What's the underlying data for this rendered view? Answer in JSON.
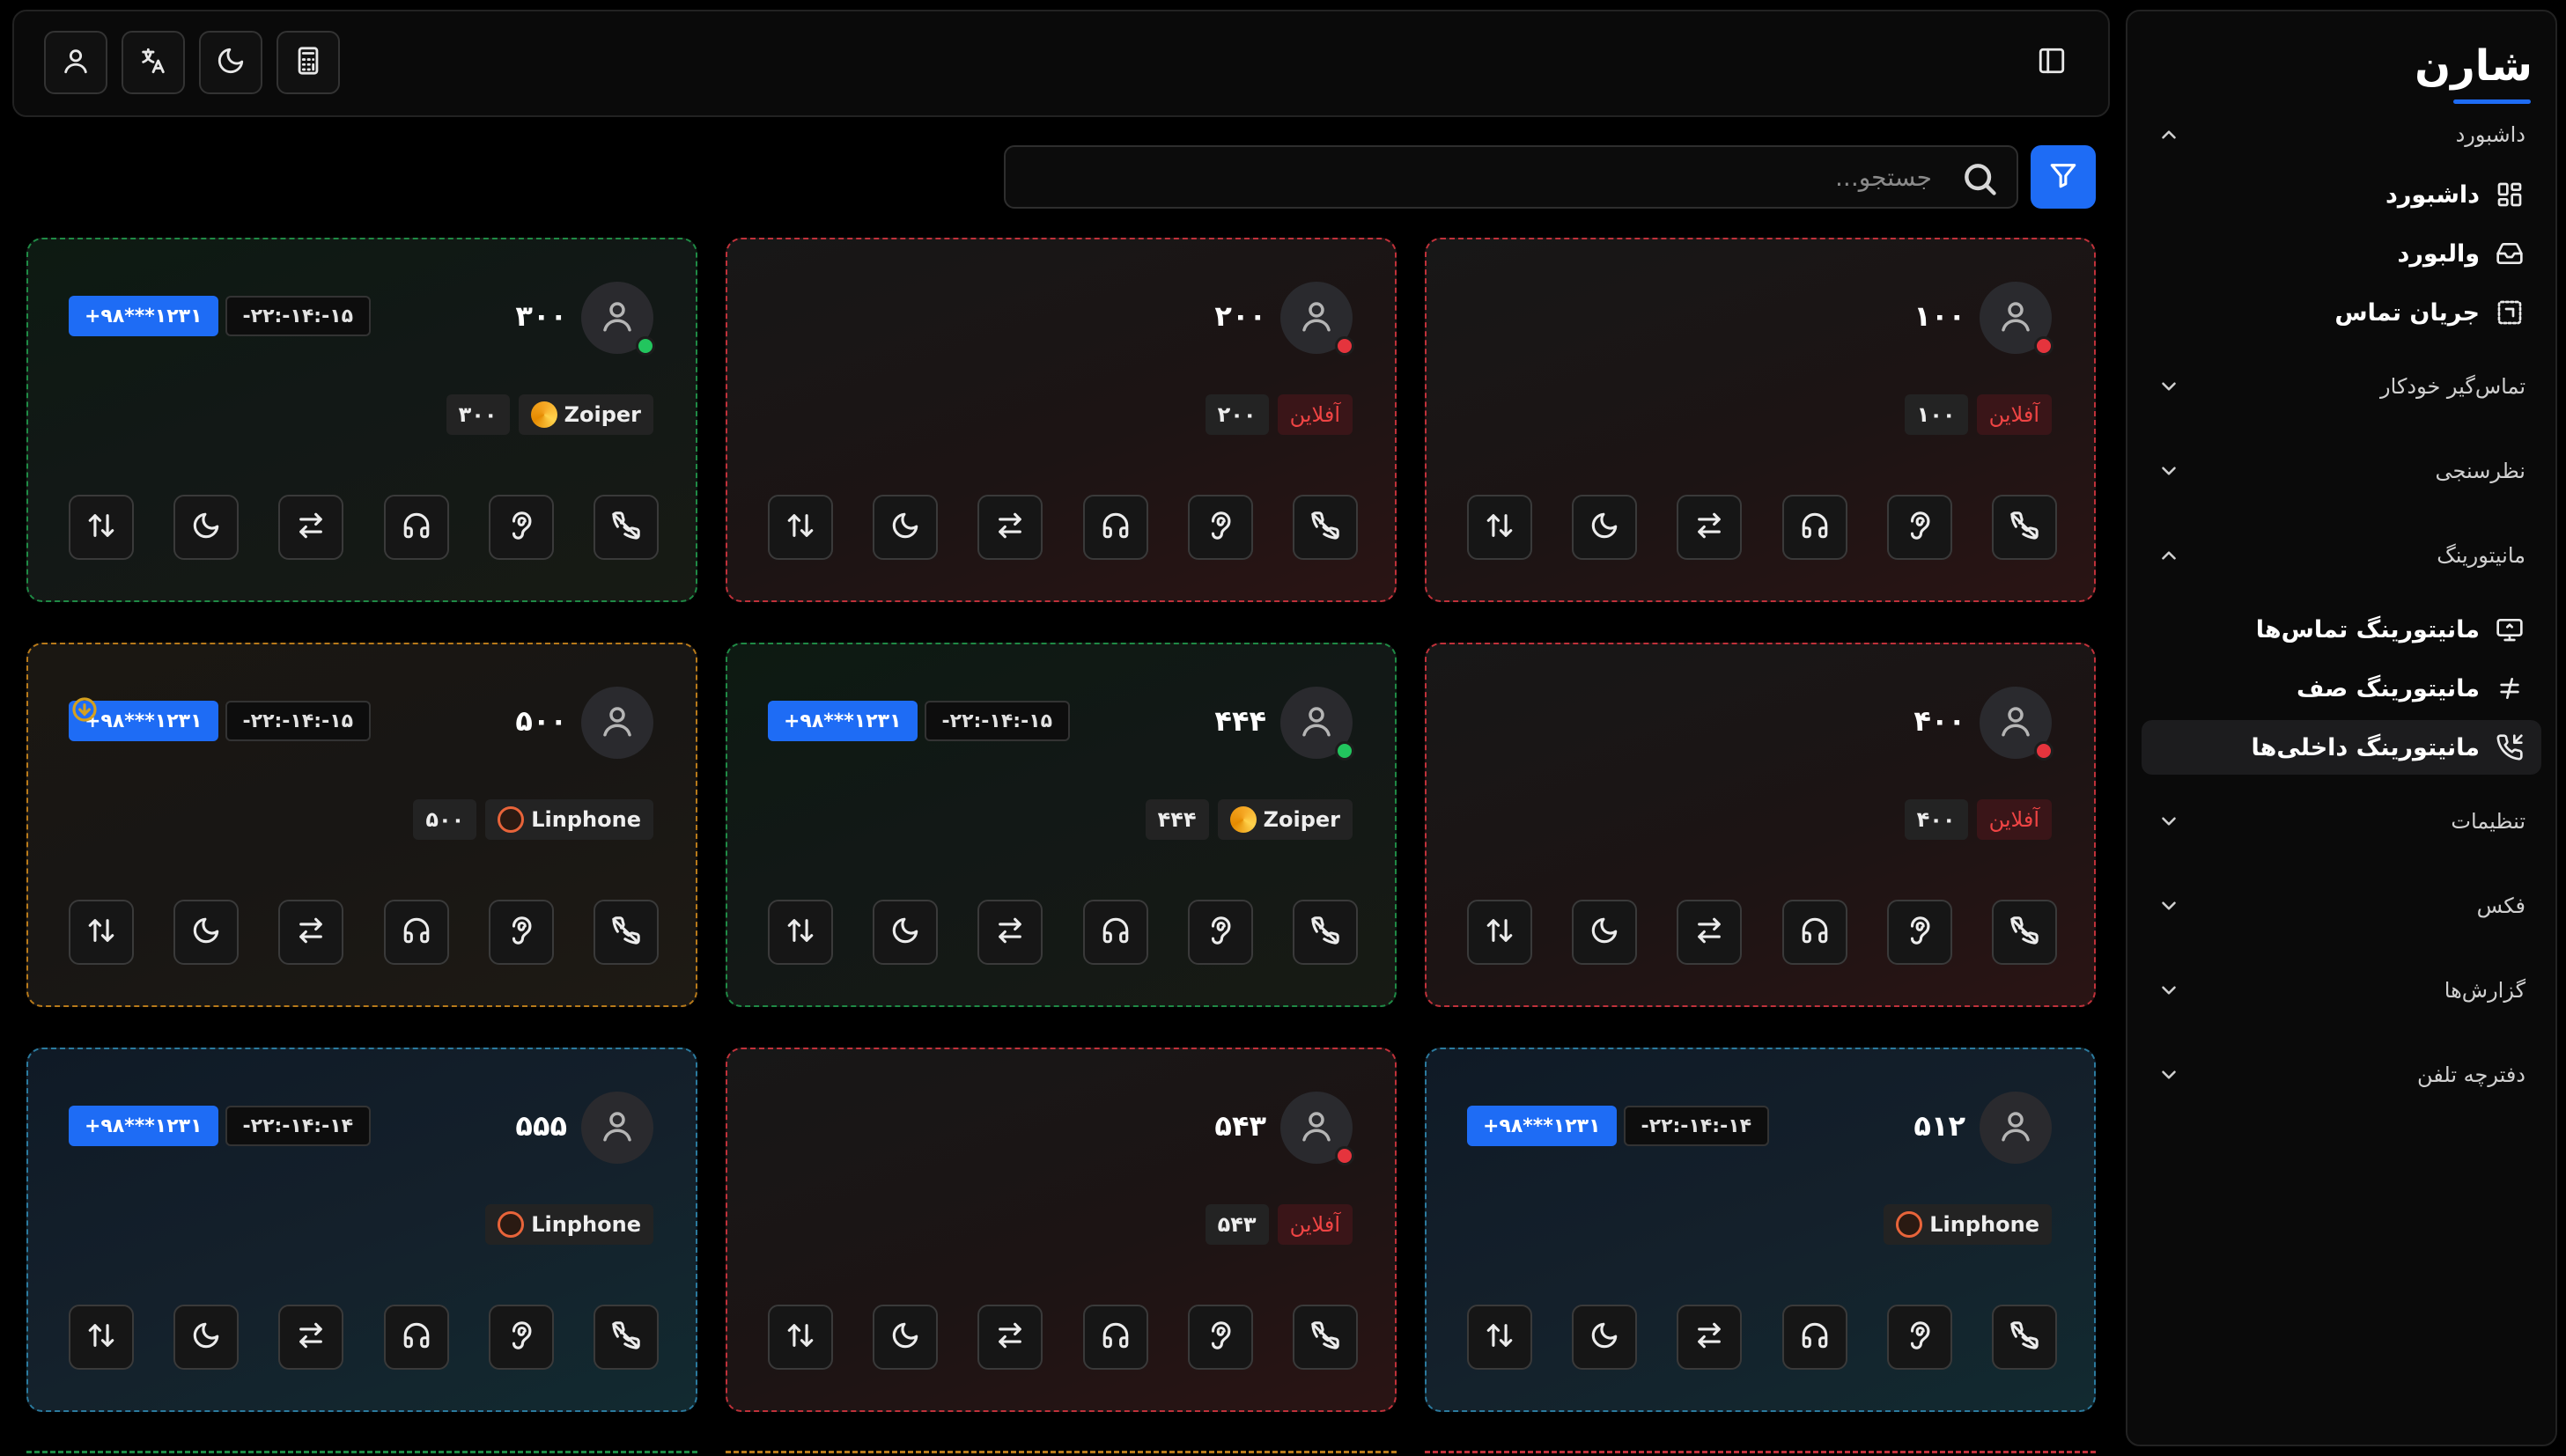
{
  "brand": {
    "name": "شارن"
  },
  "topbar": {
    "icons": [
      "user-icon",
      "translate-icon",
      "moon-icon",
      "calculator-icon"
    ]
  },
  "search": {
    "placeholder": "جستجو..."
  },
  "sidebar": {
    "groups": [
      {
        "label": "داشبورد",
        "expanded": true,
        "items": [
          {
            "label": "داشبورد",
            "icon": "grid-icon"
          },
          {
            "label": "والبورد",
            "icon": "inbox-icon"
          },
          {
            "label": "جریان تماس",
            "icon": "flow-icon"
          }
        ]
      },
      {
        "label": "تماس‌گیر خودکار",
        "expanded": false
      },
      {
        "label": "نظرسنجی",
        "expanded": false
      },
      {
        "label": "مانیتورینگ",
        "expanded": true,
        "items": [
          {
            "label": "مانیتورینگ تماس‌ها",
            "icon": "monitor-icon"
          },
          {
            "label": "مانیتورینگ صف",
            "icon": "queue-icon"
          },
          {
            "label": "مانیتورینگ داخلی‌ها",
            "icon": "phone-incoming-icon",
            "active": true
          }
        ]
      },
      {
        "label": "تنظیمات",
        "expanded": false
      },
      {
        "label": "فکس",
        "expanded": false
      },
      {
        "label": "گزارش‌ها",
        "expanded": false
      },
      {
        "label": "دفترچه تلفن",
        "expanded": false
      }
    ]
  },
  "cards": [
    {
      "ext": "۱۰۰",
      "status": "offline",
      "offline_label": "آفلاین",
      "ext_tag": "۱۰۰",
      "color": "red"
    },
    {
      "ext": "۲۰۰",
      "status": "offline",
      "offline_label": "آفلاین",
      "ext_tag": "۲۰۰",
      "color": "red"
    },
    {
      "ext": "۳۰۰",
      "status": "online",
      "client": "Zoiper",
      "ext_tag": "۳۰۰",
      "time": "-۲۲:-۱۴:-۱۵",
      "phone": "+۹۸***۱۲۳۱",
      "color": "green"
    },
    {
      "ext": "۴۰۰",
      "status": "offline",
      "offline_label": "آفلاین",
      "ext_tag": "۴۰۰",
      "color": "red"
    },
    {
      "ext": "۴۴۴",
      "status": "online",
      "client": "Zoiper",
      "ext_tag": "۴۴۴",
      "time": "-۲۲:-۱۴:-۱۵",
      "phone": "+۹۸***۱۲۳۱",
      "color": "green"
    },
    {
      "ext": "۵۰۰",
      "status": "busy",
      "client": "Linphone",
      "ext_tag": "۵۰۰",
      "time": "-۲۲:-۱۴:-۱۵",
      "phone": "+۹۸***۱۲۳۱",
      "color": "orange"
    },
    {
      "ext": "۵۱۲",
      "status": "call",
      "client": "Linphone",
      "time": "-۲۲:-۱۴:-۱۴",
      "phone": "+۹۸***۱۲۳۱",
      "color": "blue"
    },
    {
      "ext": "۵۴۳",
      "status": "offline",
      "offline_label": "آفلاین",
      "ext_tag": "۵۴۳",
      "color": "red"
    },
    {
      "ext": "۵۵۵",
      "status": "call",
      "client": "Linphone",
      "time": "-۲۲:-۱۴:-۱۴",
      "phone": "+۹۸***۱۲۳۱",
      "color": "blue"
    }
  ],
  "card_actions": [
    "hangup-icon",
    "ear-icon",
    "headset-icon",
    "transfer-icon",
    "moon-icon",
    "swap-icon"
  ],
  "colors": {
    "accent": "#1e6cf5",
    "offline": "#e5343d",
    "online": "#22c55e",
    "busy": "#d4a020",
    "call": "#2b7a9e"
  }
}
